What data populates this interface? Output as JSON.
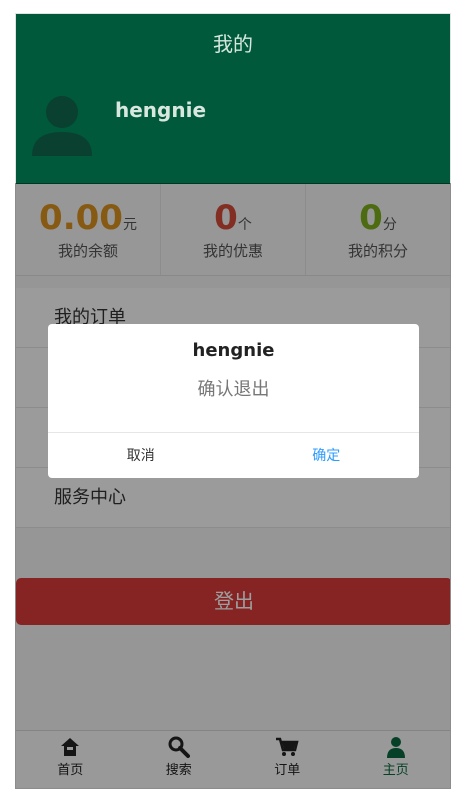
{
  "header": {
    "title": "我的",
    "username": "hengnie"
  },
  "stats": [
    {
      "value": "0.00",
      "unit": "元",
      "label": "我的余额",
      "color": "#d9921f"
    },
    {
      "value": "0",
      "unit": "个",
      "label": "我的优惠",
      "color": "#d24b38"
    },
    {
      "value": "0",
      "unit": "分",
      "label": "我的积分",
      "color": "#7dad1a"
    }
  ],
  "menu": [
    {
      "label": "我的订单"
    },
    {
      "label": ""
    },
    {
      "label": ""
    },
    {
      "label": "服务中心"
    }
  ],
  "logout_label": "登出",
  "tabbar": [
    {
      "label": "首页",
      "icon": "home-icon",
      "active": false
    },
    {
      "label": "搜索",
      "icon": "search-icon",
      "active": false
    },
    {
      "label": "订单",
      "icon": "cart-icon",
      "active": false
    },
    {
      "label": "主页",
      "icon": "user-icon",
      "active": true
    }
  ],
  "dialog": {
    "title": "hengnie",
    "message": "确认退出",
    "cancel_label": "取消",
    "confirm_label": "确定"
  },
  "colors": {
    "header_bg": "#00593a",
    "logout_bg": "#d83a3a",
    "confirm_text": "#2d9cff",
    "active_tab": "#0a6a3f"
  }
}
